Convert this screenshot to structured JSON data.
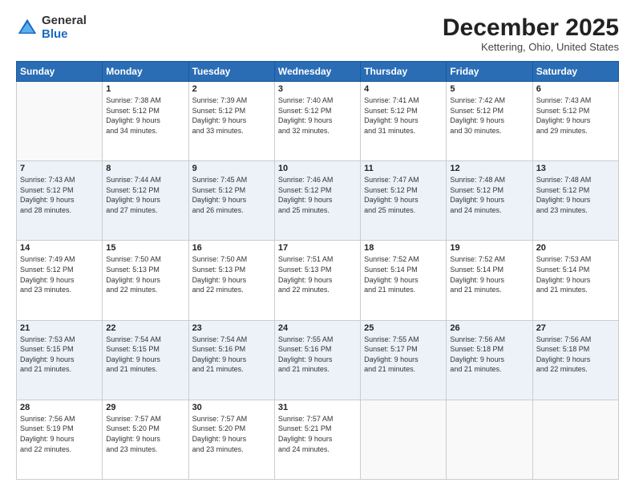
{
  "logo": {
    "general": "General",
    "blue": "Blue"
  },
  "header": {
    "month": "December 2025",
    "location": "Kettering, Ohio, United States"
  },
  "days_of_week": [
    "Sunday",
    "Monday",
    "Tuesday",
    "Wednesday",
    "Thursday",
    "Friday",
    "Saturday"
  ],
  "weeks": [
    [
      {
        "day": "",
        "info": ""
      },
      {
        "day": "1",
        "info": "Sunrise: 7:38 AM\nSunset: 5:12 PM\nDaylight: 9 hours\nand 34 minutes."
      },
      {
        "day": "2",
        "info": "Sunrise: 7:39 AM\nSunset: 5:12 PM\nDaylight: 9 hours\nand 33 minutes."
      },
      {
        "day": "3",
        "info": "Sunrise: 7:40 AM\nSunset: 5:12 PM\nDaylight: 9 hours\nand 32 minutes."
      },
      {
        "day": "4",
        "info": "Sunrise: 7:41 AM\nSunset: 5:12 PM\nDaylight: 9 hours\nand 31 minutes."
      },
      {
        "day": "5",
        "info": "Sunrise: 7:42 AM\nSunset: 5:12 PM\nDaylight: 9 hours\nand 30 minutes."
      },
      {
        "day": "6",
        "info": "Sunrise: 7:43 AM\nSunset: 5:12 PM\nDaylight: 9 hours\nand 29 minutes."
      }
    ],
    [
      {
        "day": "7",
        "info": "Sunrise: 7:43 AM\nSunset: 5:12 PM\nDaylight: 9 hours\nand 28 minutes."
      },
      {
        "day": "8",
        "info": "Sunrise: 7:44 AM\nSunset: 5:12 PM\nDaylight: 9 hours\nand 27 minutes."
      },
      {
        "day": "9",
        "info": "Sunrise: 7:45 AM\nSunset: 5:12 PM\nDaylight: 9 hours\nand 26 minutes."
      },
      {
        "day": "10",
        "info": "Sunrise: 7:46 AM\nSunset: 5:12 PM\nDaylight: 9 hours\nand 25 minutes."
      },
      {
        "day": "11",
        "info": "Sunrise: 7:47 AM\nSunset: 5:12 PM\nDaylight: 9 hours\nand 25 minutes."
      },
      {
        "day": "12",
        "info": "Sunrise: 7:48 AM\nSunset: 5:12 PM\nDaylight: 9 hours\nand 24 minutes."
      },
      {
        "day": "13",
        "info": "Sunrise: 7:48 AM\nSunset: 5:12 PM\nDaylight: 9 hours\nand 23 minutes."
      }
    ],
    [
      {
        "day": "14",
        "info": "Sunrise: 7:49 AM\nSunset: 5:12 PM\nDaylight: 9 hours\nand 23 minutes."
      },
      {
        "day": "15",
        "info": "Sunrise: 7:50 AM\nSunset: 5:13 PM\nDaylight: 9 hours\nand 22 minutes."
      },
      {
        "day": "16",
        "info": "Sunrise: 7:50 AM\nSunset: 5:13 PM\nDaylight: 9 hours\nand 22 minutes."
      },
      {
        "day": "17",
        "info": "Sunrise: 7:51 AM\nSunset: 5:13 PM\nDaylight: 9 hours\nand 22 minutes."
      },
      {
        "day": "18",
        "info": "Sunrise: 7:52 AM\nSunset: 5:14 PM\nDaylight: 9 hours\nand 21 minutes."
      },
      {
        "day": "19",
        "info": "Sunrise: 7:52 AM\nSunset: 5:14 PM\nDaylight: 9 hours\nand 21 minutes."
      },
      {
        "day": "20",
        "info": "Sunrise: 7:53 AM\nSunset: 5:14 PM\nDaylight: 9 hours\nand 21 minutes."
      }
    ],
    [
      {
        "day": "21",
        "info": "Sunrise: 7:53 AM\nSunset: 5:15 PM\nDaylight: 9 hours\nand 21 minutes."
      },
      {
        "day": "22",
        "info": "Sunrise: 7:54 AM\nSunset: 5:15 PM\nDaylight: 9 hours\nand 21 minutes."
      },
      {
        "day": "23",
        "info": "Sunrise: 7:54 AM\nSunset: 5:16 PM\nDaylight: 9 hours\nand 21 minutes."
      },
      {
        "day": "24",
        "info": "Sunrise: 7:55 AM\nSunset: 5:16 PM\nDaylight: 9 hours\nand 21 minutes."
      },
      {
        "day": "25",
        "info": "Sunrise: 7:55 AM\nSunset: 5:17 PM\nDaylight: 9 hours\nand 21 minutes."
      },
      {
        "day": "26",
        "info": "Sunrise: 7:56 AM\nSunset: 5:18 PM\nDaylight: 9 hours\nand 21 minutes."
      },
      {
        "day": "27",
        "info": "Sunrise: 7:56 AM\nSunset: 5:18 PM\nDaylight: 9 hours\nand 22 minutes."
      }
    ],
    [
      {
        "day": "28",
        "info": "Sunrise: 7:56 AM\nSunset: 5:19 PM\nDaylight: 9 hours\nand 22 minutes."
      },
      {
        "day": "29",
        "info": "Sunrise: 7:57 AM\nSunset: 5:20 PM\nDaylight: 9 hours\nand 23 minutes."
      },
      {
        "day": "30",
        "info": "Sunrise: 7:57 AM\nSunset: 5:20 PM\nDaylight: 9 hours\nand 23 minutes."
      },
      {
        "day": "31",
        "info": "Sunrise: 7:57 AM\nSunset: 5:21 PM\nDaylight: 9 hours\nand 24 minutes."
      },
      {
        "day": "",
        "info": ""
      },
      {
        "day": "",
        "info": ""
      },
      {
        "day": "",
        "info": ""
      }
    ]
  ]
}
